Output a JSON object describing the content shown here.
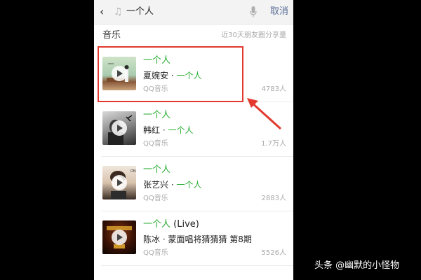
{
  "search": {
    "back_icon": "chevron-left-icon",
    "note_icon": "music-note-icon",
    "query": "一个人",
    "mic_icon": "microphone-icon",
    "cancel_label": "取消"
  },
  "section": {
    "title": "音乐",
    "note": "近30天朋友圈分享量"
  },
  "results": [
    {
      "title": "一个人",
      "title_suffix": "",
      "artist": "夏婉安",
      "separator": " · ",
      "album": "一个人",
      "source": "QQ音乐",
      "count": "4783人"
    },
    {
      "title": "一个人",
      "title_suffix": "",
      "artist": "韩红",
      "separator": " · ",
      "album": "一个人",
      "source": "QQ音乐",
      "count": "1.7万人"
    },
    {
      "title": "一个人",
      "title_suffix": "",
      "artist": "张艺兴",
      "separator": " · ",
      "album": "一个人",
      "source": "QQ音乐",
      "count": "2883人"
    },
    {
      "title": "一个人",
      "title_suffix": " (Live)",
      "artist": "陈冰",
      "separator": " · ",
      "album": "蒙面唱将猜猜猜 第8期",
      "source": "QQ音乐",
      "count": "5526人"
    }
  ],
  "watermark": "头条 @幽默的小怪物",
  "colors": {
    "accent_green": "#2aae33",
    "link_blue": "#576b95",
    "annotation_red": "#e3392f"
  }
}
